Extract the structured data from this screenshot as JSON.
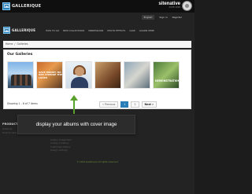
{
  "frame": {
    "logo_text": "GALLERIQUE",
    "brand_name": "sitenative",
    "brand_sub": "SUITE APPS"
  },
  "site": {
    "util": {
      "language": "English",
      "signin": "Sign in",
      "register": "Register"
    },
    "logo_text": "GALLERIQUE",
    "nav": [
      "HOW TO GO",
      "NEW COLLECTIONS",
      "IMPRESSIONS",
      "PHOTO EFFECTS",
      "CAKE",
      "LOGINS HERE"
    ],
    "breadcrumb": {
      "home": "Home",
      "sep": "/",
      "current": "Galleries"
    }
  },
  "galleries": {
    "title": "Our Galleries",
    "thumbnails": [
      {
        "caption": ""
      },
      {
        "caption": "SAVE MONEY, DO NOT CHANGE THE LOCKS"
      },
      {
        "caption": ""
      },
      {
        "caption": ""
      },
      {
        "caption": ""
      },
      {
        "caption": "DEMONSTRATION"
      }
    ],
    "showing": "Showing 1 - 6 of 7 items",
    "pager": {
      "previous": "« Previous",
      "page1": "1",
      "page2": "2",
      "next": "Next »"
    }
  },
  "callout": {
    "text": "display your albums with cover image"
  },
  "footer": {
    "heading": "PRODUCTS",
    "links_left": [
      "Galleries",
      "Product listing"
    ],
    "col": [
      "Gallery Image Item",
      "Listing in Gallery",
      "Customize Gallery",
      "Design settings"
    ],
    "copyright": "© 2014 Gallerique all rights reserved"
  }
}
